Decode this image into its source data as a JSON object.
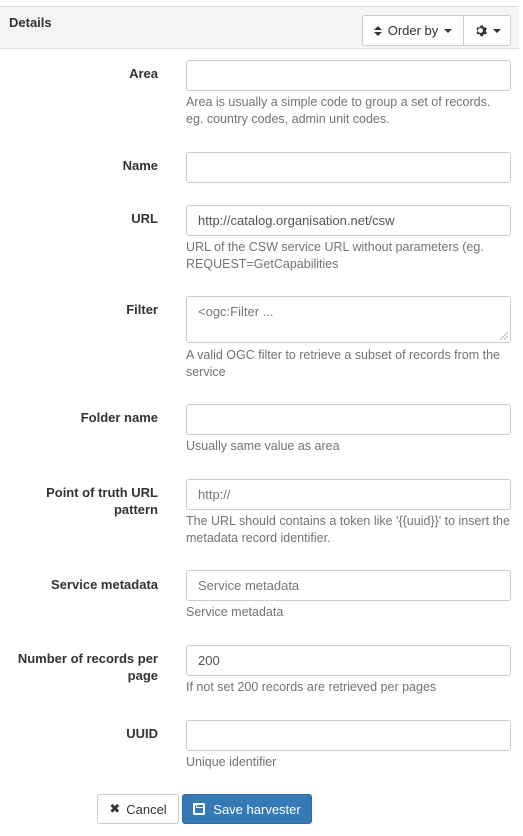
{
  "header": {
    "title": "Details",
    "order_by_label": "Order by"
  },
  "fields": {
    "area": {
      "label": "Area",
      "value": "",
      "help": "Area is usually a simple code to group a set of records. eg. country codes, admin unit codes."
    },
    "name": {
      "label": "Name",
      "value": ""
    },
    "url": {
      "label": "URL",
      "value": "http://catalog.organisation.net/csw",
      "help": "URL of the CSW service URL without parameters (eg. REQUEST=GetCapabilities"
    },
    "filter": {
      "label": "Filter",
      "placeholder": "<ogc:Filter ...",
      "help": "A valid OGC filter to retrieve a subset of records from the service"
    },
    "folder_name": {
      "label": "Folder name",
      "value": "",
      "help": "Usually same value as area"
    },
    "point_of_truth": {
      "label": "Point of truth URL pattern",
      "placeholder": "http://",
      "help": "The URL should contains a token like '{{uuid}}' to insert the metadata record identifier."
    },
    "service_metadata": {
      "label": "Service metadata",
      "placeholder": "Service metadata",
      "help": "Service metadata"
    },
    "records_per_page": {
      "label": "Number of records per page",
      "value": "200",
      "help": "If not set 200 records are retrieved per pages"
    },
    "uuid": {
      "label": "UUID",
      "value": "",
      "help": "Unique identifier"
    }
  },
  "actions": {
    "cancel_label": "Cancel",
    "save_label": "Save harvester"
  },
  "icons": {
    "sort": "sort-icon",
    "gear": "gear-icon",
    "close": "close-icon",
    "save": "floppy-disk-icon"
  },
  "colors": {
    "primary": "#337ab7",
    "heading_bg": "#f5f5f5",
    "help_text": "#737373"
  }
}
